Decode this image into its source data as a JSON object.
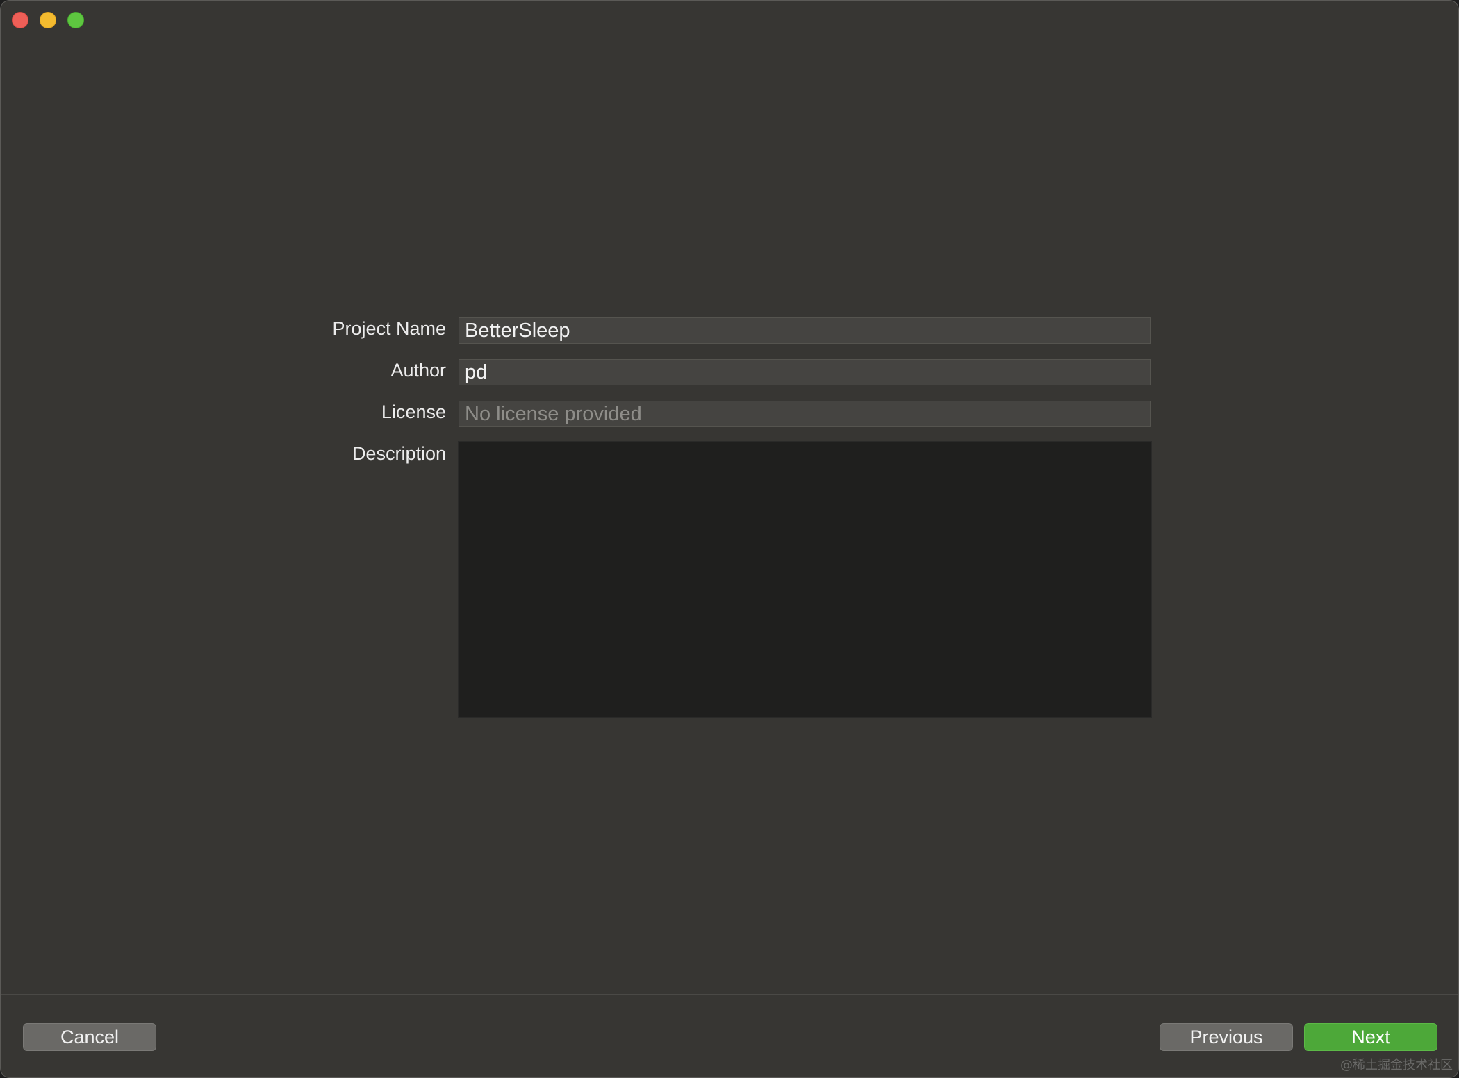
{
  "form": {
    "project_name_label": "Project Name",
    "project_name_value": "BetterSleep",
    "author_label": "Author",
    "author_value": "pd",
    "license_label": "License",
    "license_placeholder": "No license provided",
    "license_value": "",
    "description_label": "Description",
    "description_value": ""
  },
  "footer": {
    "cancel_label": "Cancel",
    "previous_label": "Previous",
    "next_label": "Next"
  },
  "watermark": "@稀土掘金技术社区",
  "colors": {
    "window_bg": "#373633",
    "next_accent": "#4da839",
    "close": "#ee5f57",
    "minimize": "#f4bb2f",
    "zoom": "#5ec640"
  }
}
